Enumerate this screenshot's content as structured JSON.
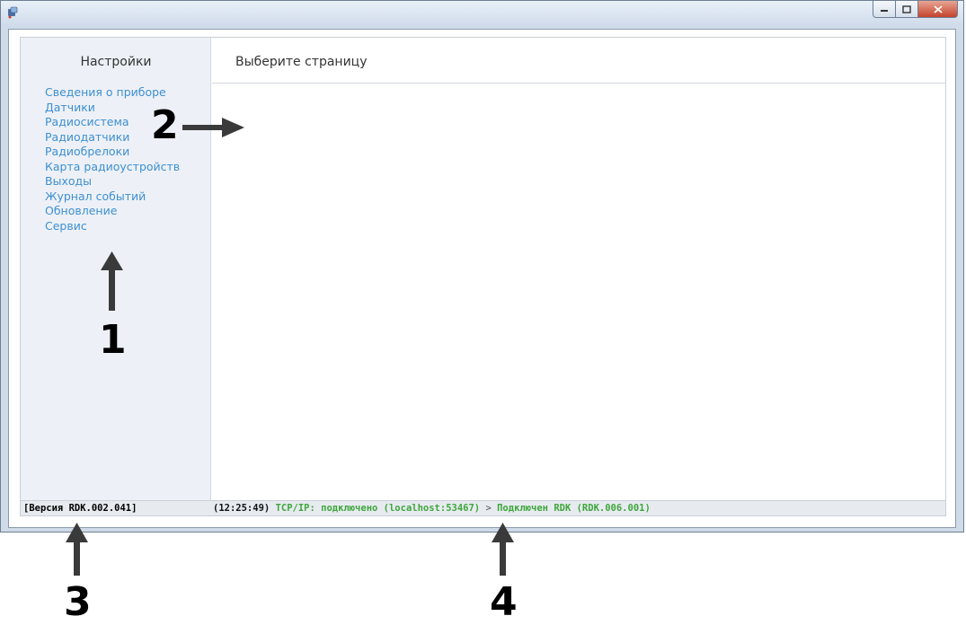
{
  "sidebar": {
    "title": "Настройки",
    "items": [
      {
        "label": "Сведения о приборе"
      },
      {
        "label": "Датчики"
      },
      {
        "label": "Радиосистема"
      },
      {
        "label": "Радиодатчики"
      },
      {
        "label": "Радиобрелоки"
      },
      {
        "label": "Карта радиоустройств"
      },
      {
        "label": "Выходы"
      },
      {
        "label": "Журнал событий"
      },
      {
        "label": "Обновление"
      },
      {
        "label": "Сервис"
      }
    ]
  },
  "main": {
    "title": "Выберите страницу"
  },
  "status": {
    "version": "[Версия RDK.002.041]",
    "time": "(12:25:49)",
    "tcp": "TCP/IP: подключено (localhost:53467)",
    "separator": ">",
    "device": "Подключен RDK (RDK.006.001)"
  },
  "annotations": {
    "n1": "1",
    "n2": "2",
    "n3": "3",
    "n4": "4"
  },
  "colors": {
    "link": "#3e8fd0",
    "status_green": "#3ea63a",
    "sidebar_bg": "#edf1f7",
    "window_frame": "#cfdbe9"
  }
}
